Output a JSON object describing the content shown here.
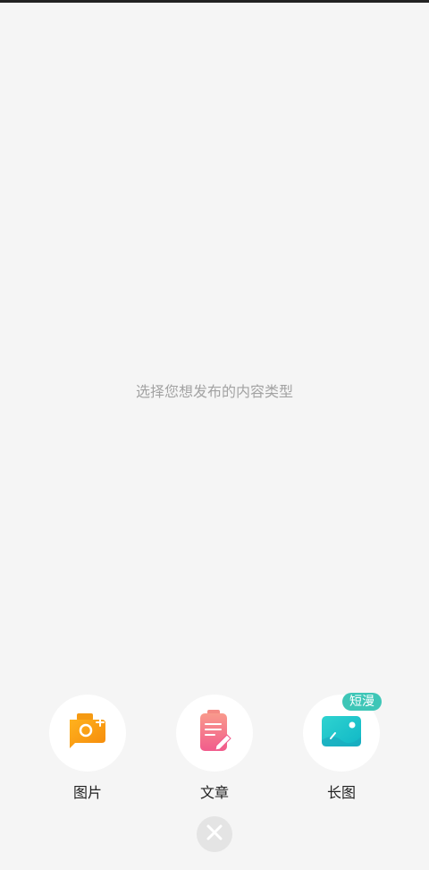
{
  "prompt": "选择您想发布的内容类型",
  "options": [
    {
      "label": "图片",
      "icon": "camera-icon",
      "color": "#f7a21b"
    },
    {
      "label": "文章",
      "icon": "article-edit-icon",
      "color": "#f46b8a"
    },
    {
      "label": "长图",
      "icon": "long-image-icon",
      "color": "#16c3c0",
      "badge": "短漫"
    }
  ],
  "close": {
    "icon": "close-icon"
  }
}
